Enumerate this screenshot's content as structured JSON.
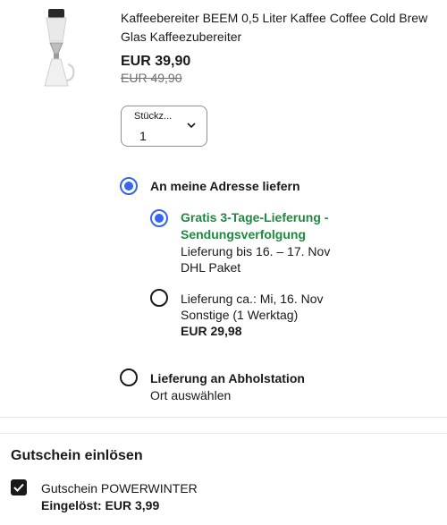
{
  "product": {
    "title": "Kaffeebereiter BEEM 0,5 Liter Kaffee Coffee Cold Brew Glas Kaffeezubereiter",
    "price": "EUR 39,90",
    "original_price": "EUR 49,90"
  },
  "quantity": {
    "label": "Stückz...",
    "value": "1"
  },
  "delivery": {
    "home": {
      "label": "An meine Adresse liefern",
      "options": [
        {
          "title": "Gratis 3-Tage-Lieferung - Sendungsverfolgung",
          "line1": "Lieferung bis 16. – 17. Nov",
          "line2": "DHL Paket",
          "selected": true
        },
        {
          "line1": "Lieferung ca.: Mi, 16. Nov",
          "line2": "Sonstige (1 Werktag)",
          "price": "EUR 29,98",
          "selected": false
        }
      ]
    },
    "pickup": {
      "label": "Lieferung an Abholstation",
      "sub": "Ort auswählen"
    }
  },
  "coupon": {
    "heading": "Gutschein einlösen",
    "name": "Gutschein POWERWINTER",
    "applied": "Eingelöst: EUR 3,99"
  },
  "colors": {
    "accent": "#3665f3",
    "green": "#1f8a3f",
    "text": "#191919"
  }
}
